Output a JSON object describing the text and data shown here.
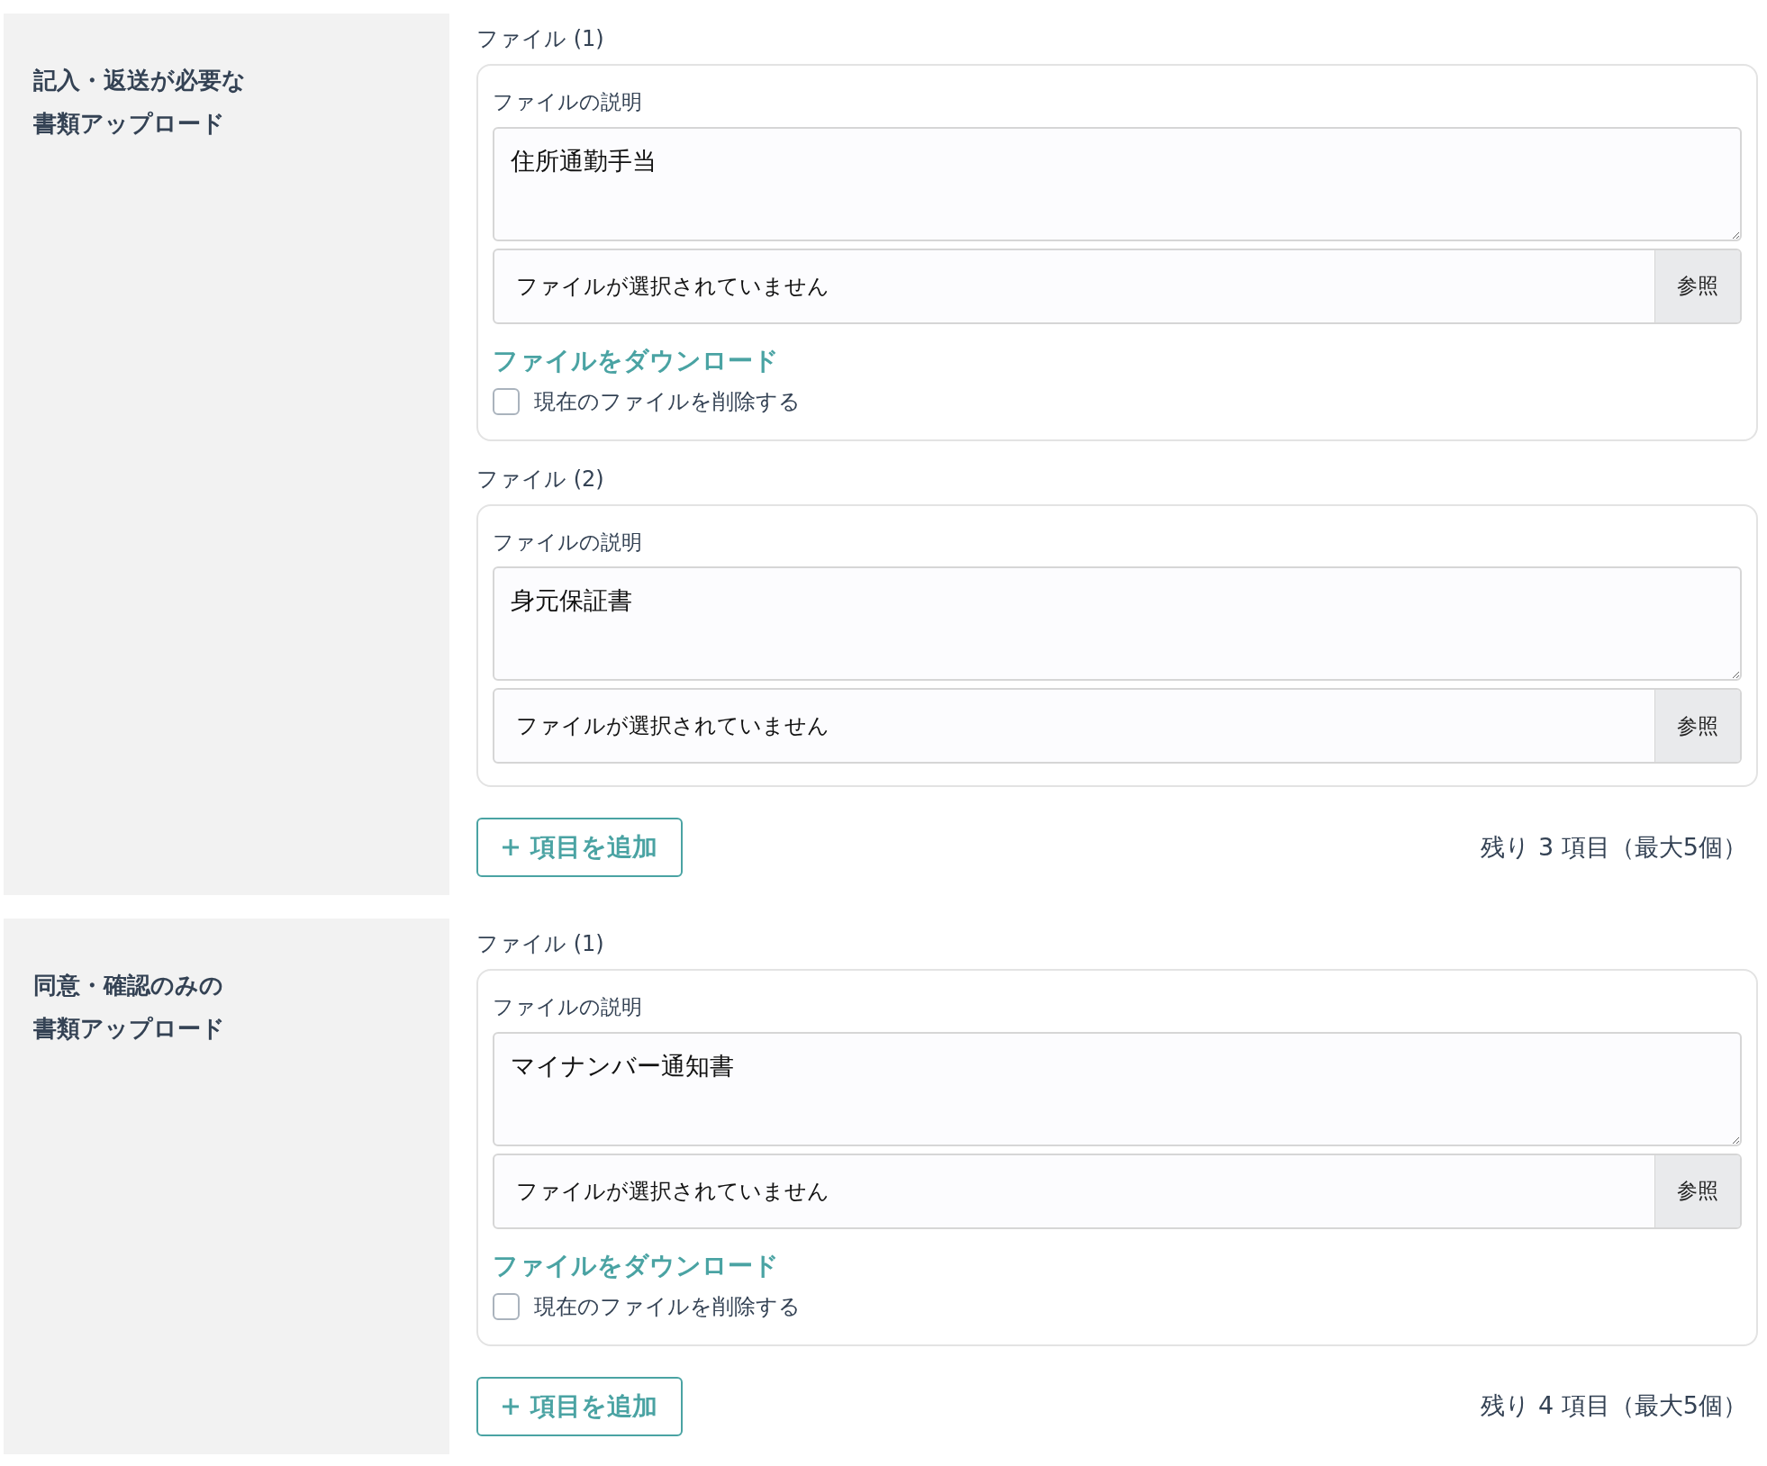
{
  "sections": [
    {
      "title_lines": [
        "記入・返送が必要な",
        "書類アップロード"
      ],
      "files": [
        {
          "label": "ファイル (1)",
          "description_label": "ファイルの説明",
          "description": "住所通勤手当",
          "file_status": "ファイルが選択されていません",
          "browse_button": "参照",
          "download_link": "ファイルをダウンロード",
          "delete_checkbox": {
            "label": "現在のファイルを削除する",
            "checked": false
          }
        },
        {
          "label": "ファイル (2)",
          "description_label": "ファイルの説明",
          "description": "身元保証書",
          "file_status": "ファイルが選択されていません",
          "browse_button": "参照"
        }
      ],
      "add_button": "項目を追加",
      "remaining": "残り 3 項目（最大5個）"
    },
    {
      "title_lines": [
        "同意・確認のみの",
        "書類アップロード"
      ],
      "files": [
        {
          "label": "ファイル (1)",
          "description_label": "ファイルの説明",
          "description": "マイナンバー通知書",
          "file_status": "ファイルが選択されていません",
          "browse_button": "参照",
          "download_link": "ファイルをダウンロード",
          "delete_checkbox": {
            "label": "現在のファイルを削除する",
            "checked": false
          }
        }
      ],
      "add_button": "項目を追加",
      "remaining": "残り 4 項目（最大5個）"
    }
  ]
}
